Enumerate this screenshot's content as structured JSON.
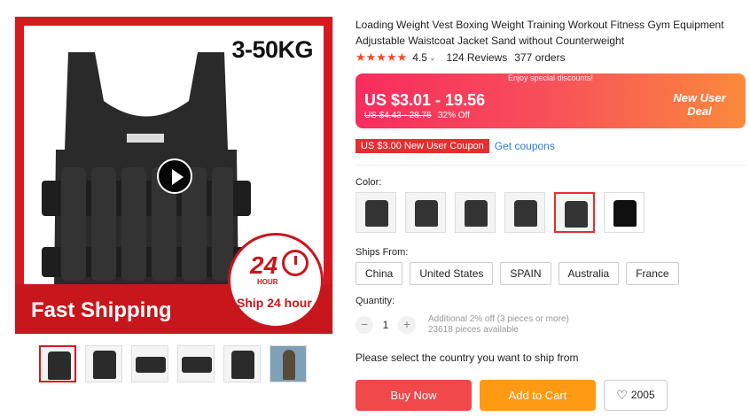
{
  "gallery": {
    "main_weight_badge": "3-50KG",
    "banner_text": "Fast Shipping",
    "ship_hours": "24",
    "ship_hours_label": "HOUR",
    "ship_sub": "Ship 24 hour",
    "thumbs": [
      "vest-front",
      "vest-angle",
      "vest-open",
      "vest-straps",
      "vest-pockets",
      "person-photo"
    ]
  },
  "product": {
    "title": "Loading Weight Vest Boxing Weight Training Workout Fitness Gym Equipment Adjustable Waistcoat Jacket Sand without Counterweight",
    "stars": "★★★★★",
    "rating": "4.5",
    "reviews": "124 Reviews",
    "orders": "377 orders"
  },
  "price": {
    "promo_top": "Enjoy special discounts!",
    "range": "US $3.01 - 19.56",
    "old": "US $4.43 - 28.76",
    "off": "32% Off",
    "new_user": "New User Deal"
  },
  "coupon": {
    "tag": "US $3.00 New User Coupon",
    "link": "Get coupons"
  },
  "color": {
    "label": "Color:",
    "selected_index": 4,
    "count": 6
  },
  "shipping": {
    "label": "Ships From:",
    "options": [
      "China",
      "United States",
      "SPAIN",
      "Australia",
      "France"
    ]
  },
  "quantity": {
    "label": "Quantity:",
    "value": "1",
    "minus": "−",
    "plus": "+",
    "discount": "Additional 2% off (3 pieces or more)",
    "available": "23618 pieces available"
  },
  "notice": "Please select the country you want to ship from",
  "actions": {
    "buy_now": "Buy Now",
    "add_to_cart": "Add to Cart",
    "wishlist_count": "2005"
  },
  "colors": {
    "accent": "#e62e2e",
    "buy_now": "#f0484b",
    "add_to_cart": "#ff9a12",
    "link": "#2e7ad1"
  }
}
